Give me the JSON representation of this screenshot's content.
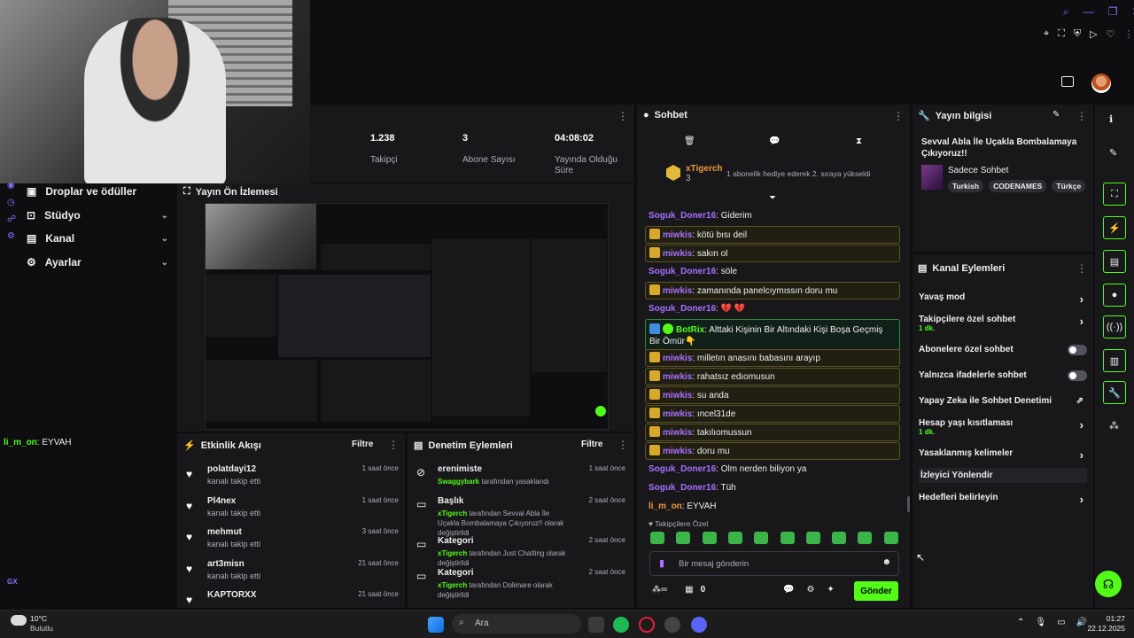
{
  "colors": {
    "accent": "#53fc18",
    "bg": "#0e0e10",
    "panel": "#18181b",
    "muted": "#adadb8",
    "purple": "#a970ff",
    "orange": "#f19a38"
  },
  "sidebar": {
    "items": [
      {
        "label": "Droplar ve ödüller",
        "icon": "gift-icon"
      },
      {
        "label": "Stüdyo",
        "icon": "studio-icon"
      },
      {
        "label": "Kanal",
        "icon": "channel-icon"
      },
      {
        "label": "Ayarlar",
        "icon": "gear-icon"
      }
    ]
  },
  "stats": [
    {
      "value": "1.238",
      "label": "Takipçi"
    },
    {
      "value": "3",
      "label": "Abone Sayısı"
    },
    {
      "value": "04:08:02",
      "label": "Yayında Olduğu Süre"
    }
  ],
  "left_chat": {
    "user": "li_m_on",
    "text": ": EYVAH"
  },
  "preview": {
    "title": "Yayın Ön İzlemesi"
  },
  "activity": {
    "title": "Etkinlik Akışı",
    "filter": "Filtre",
    "items": [
      {
        "name": "polatdayi12",
        "sub": "kanalı takip etti",
        "time": "1 saat önce"
      },
      {
        "name": "Pl4nex",
        "sub": "kanalı takip etti",
        "time": "1 saat önce"
      },
      {
        "name": "mehmut",
        "sub": "kanalı takip etti",
        "time": "3 saat önce"
      },
      {
        "name": "art3misn",
        "sub": "kanalı takip etti",
        "time": "21 saat önce"
      },
      {
        "name": "KAPTORXX",
        "sub": "",
        "time": "21 saat önce"
      }
    ]
  },
  "moderation": {
    "title": "Denetim Eylemleri",
    "filter": "Filtre",
    "items": [
      {
        "name": "erenimiste",
        "actor": "Swaggybark",
        "rest": " tarafından yasaklandı",
        "time": "1 saat önce"
      },
      {
        "name": "Başlık",
        "actor": "xTigerch",
        "rest": " tarafından Sevval Abla İle Uçakla Bombalamaya Çıkıyoruz!! olarak değiştirildi",
        "time": "2 saat önce"
      },
      {
        "name": "Kategori",
        "actor": "xTigerch",
        "rest": " tarafından Just Chatting olarak değiştirildi",
        "time": "2 saat önce"
      },
      {
        "name": "Kategori",
        "actor": "xTigerch",
        "rest": " tarafından Dolimare olarak değiştirildi",
        "time": "2 saat önce"
      }
    ]
  },
  "chat": {
    "title": "Sohbet",
    "pinned_user": "xTigerch",
    "pinned_count": "3",
    "pinned_text": "1 abonelik hediye ederek 2. sıraya yükseldi",
    "messages": [
      {
        "user": "Soguk_Doner16",
        "text": ": Giderim",
        "style": "plain",
        "color": "u-p"
      },
      {
        "user": "miwkis",
        "text": ": kötü bısı deil",
        "style": "hl",
        "color": "u-p"
      },
      {
        "user": "miwkis",
        "text": ": sakın ol",
        "style": "hl",
        "color": "u-p"
      },
      {
        "user": "Soguk_Doner16",
        "text": ": söle",
        "style": "plain",
        "color": "u-p"
      },
      {
        "user": "miwkis",
        "text": ": zamanında panelcıymıssın doru mu",
        "style": "hl",
        "color": "u-p"
      },
      {
        "user": "Soguk_Doner16",
        "text": ": 💔 💔",
        "style": "plain",
        "color": "u-p"
      },
      {
        "user": "BotRix",
        "text": ": Alttaki Kişinin Bir Altındaki Kişi Boşa Geçmiş Bir Ömür👇",
        "style": "bot",
        "color": "u-p"
      },
      {
        "user": "miwkis",
        "text": ": milletın anasını babasını arayıp",
        "style": "hl",
        "color": "u-p"
      },
      {
        "user": "miwkis",
        "text": ": rahatsız edıomusun",
        "style": "hl",
        "color": "u-p"
      },
      {
        "user": "miwkis",
        "text": ": su anda",
        "style": "hl",
        "color": "u-p"
      },
      {
        "user": "miwkis",
        "text": ": ıncel31de",
        "style": "hl",
        "color": "u-p"
      },
      {
        "user": "miwkis",
        "text": ": takılıomussun",
        "style": "hl",
        "color": "u-p"
      },
      {
        "user": "miwkis",
        "text": ": doru mu",
        "style": "hl",
        "color": "u-p"
      },
      {
        "user": "Soguk_Doner16",
        "text": ": Olm nerden biliyon ya",
        "style": "plain",
        "color": "u-p"
      },
      {
        "user": "Soguk_Doner16",
        "text": ": Tüh",
        "style": "plain",
        "color": "u-p"
      },
      {
        "user": "li_m_on",
        "text": ": EYVAH",
        "style": "plain",
        "color": "u-o"
      }
    ],
    "emote_section": "Takipçilere Özel",
    "input_placeholder": "Bir mesaj gönderin",
    "points": "0",
    "send": "Gönder"
  },
  "stream_info": {
    "title": "Yayın bilgisi",
    "stream_title": "Sevval Abla İle Uçakla Bombalamaya Çıkıyoruz!!",
    "category": "Sadece Sohbet",
    "tags": [
      "Turkish",
      "CODENAMES",
      "Türkçe"
    ]
  },
  "channel_actions": {
    "title": "Kanal Eylemleri",
    "items": [
      {
        "label": "Yavaş mod",
        "sub": "",
        "kind": "chev"
      },
      {
        "label": "Takipçilere özel sohbet",
        "sub": "1 dk.",
        "kind": "chev"
      },
      {
        "label": "Abonelere özel sohbet",
        "sub": "",
        "kind": "toggle"
      },
      {
        "label": "Yalnızca ifadelerle sohbet",
        "sub": "",
        "kind": "toggle"
      },
      {
        "label": "Yapay Zeka ile Sohbet Denetimi",
        "sub": "",
        "kind": "ext"
      },
      {
        "label": "Hesap yaşı kısıtlaması",
        "sub": "1 dk.",
        "kind": "chev"
      },
      {
        "label": "Yasaklanmış kelimeler",
        "sub": "",
        "kind": "chev"
      },
      {
        "label": "İzleyici Yönlendir",
        "sub": "",
        "kind": "none"
      },
      {
        "label": "Hedefleri belirleyin",
        "sub": "",
        "kind": "chev"
      }
    ]
  },
  "taskbar": {
    "weather_temp": "10°C",
    "weather_desc": "Bulutlu",
    "search": "Ara",
    "time": "01:27",
    "date": "22.12.2025"
  },
  "gx_label": "GX"
}
